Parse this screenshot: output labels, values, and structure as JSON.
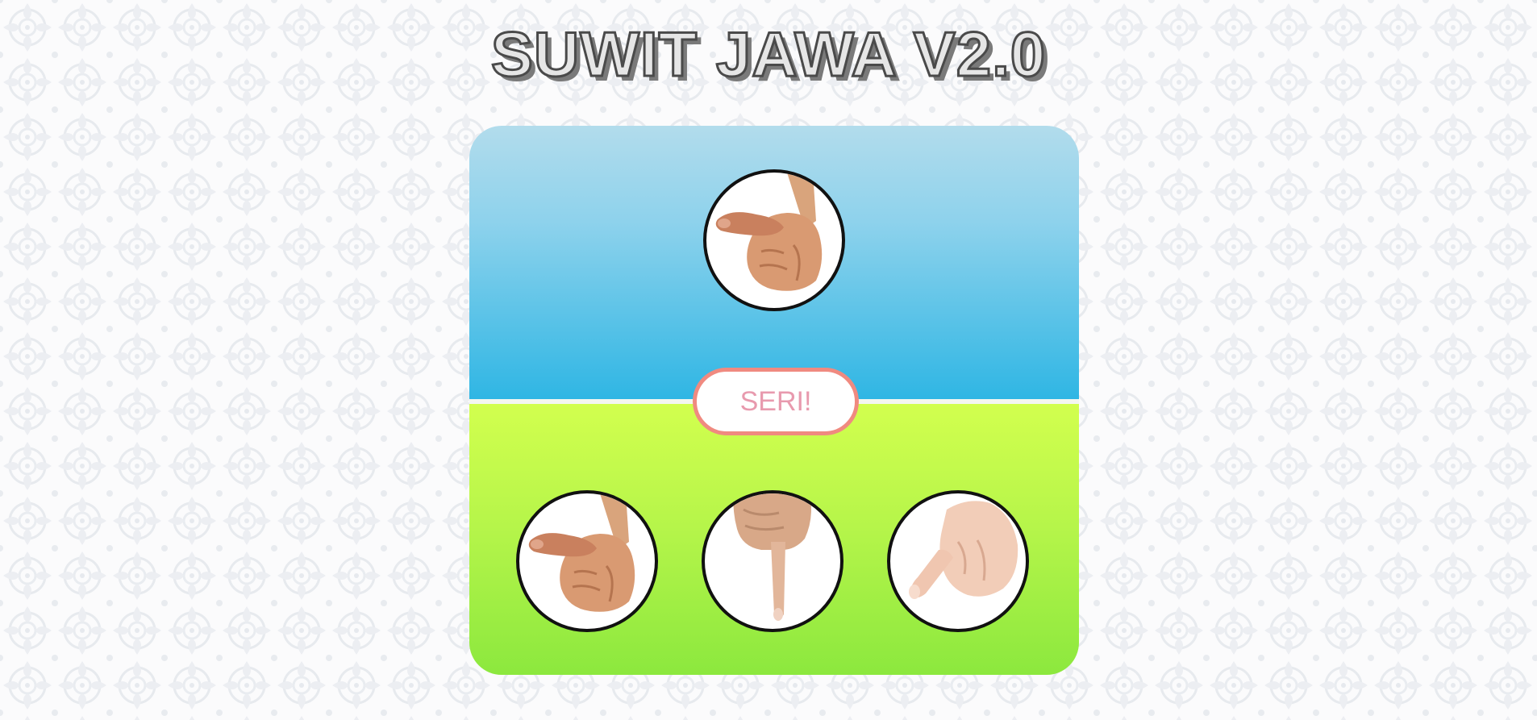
{
  "title": "SUWIT JAWA V2.0",
  "result": "SERI!",
  "computer_hand": "thumb",
  "player_choices": [
    "thumb",
    "index-finger",
    "pinky-finger"
  ],
  "colors": {
    "top_panel": "#2fb6e4",
    "bottom_panel": "#a8f046",
    "result_border": "#f08a80",
    "result_text": "#e89aae",
    "title_fill": "#e6e6e6",
    "title_stroke": "#4a4a4a"
  }
}
